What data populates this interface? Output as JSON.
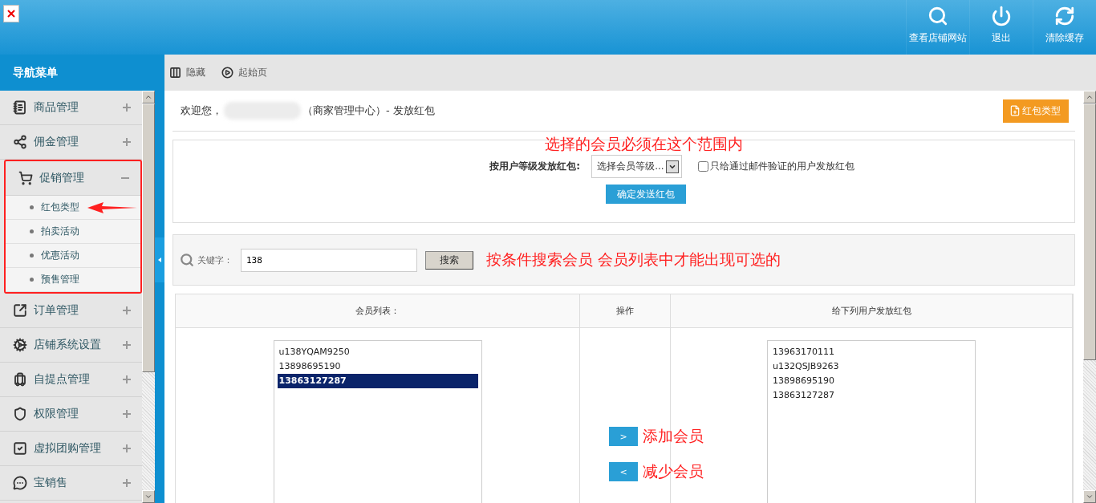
{
  "header": {
    "actions": [
      {
        "label": "查看店铺网站"
      },
      {
        "label": "退出"
      },
      {
        "label": "清除缓存"
      }
    ]
  },
  "sidebar": {
    "title": "导航菜单",
    "items": [
      {
        "label": "商品管理",
        "expanded": false,
        "highlighted": false
      },
      {
        "label": "佣金管理",
        "expanded": false,
        "highlighted": false
      },
      {
        "label": "促销管理",
        "expanded": true,
        "highlighted": true,
        "children": [
          {
            "label": "红包类型",
            "pointed": true
          },
          {
            "label": "拍卖活动",
            "pointed": false
          },
          {
            "label": "优惠活动",
            "pointed": false
          },
          {
            "label": "预售管理",
            "pointed": false
          }
        ]
      },
      {
        "label": "订单管理",
        "expanded": false,
        "highlighted": false
      },
      {
        "label": "店铺系统设置",
        "expanded": false,
        "highlighted": false
      },
      {
        "label": "自提点管理",
        "expanded": false,
        "highlighted": false
      },
      {
        "label": "权限管理",
        "expanded": false,
        "highlighted": false
      },
      {
        "label": "虚拟团购管理",
        "expanded": false,
        "highlighted": false
      },
      {
        "label": "宝销售",
        "expanded": false,
        "highlighted": false
      }
    ]
  },
  "toolbar": {
    "buttons": [
      {
        "label": "隐藏"
      },
      {
        "label": "起始页"
      }
    ]
  },
  "page": {
    "welcome": "欢迎您，",
    "title": "（商家管理中心）- 发放红包",
    "type_button": "红包类型"
  },
  "rank_panel": {
    "annotation": "选择的会员必须在这个范围内",
    "label": "按用户等级发放红包:",
    "select_value": "选择会员等级...",
    "checkbox": {
      "label": "只给通过邮件验证的用户发放红包",
      "checked": false
    },
    "submit": "确定发送红包"
  },
  "search": {
    "label": "关键字：",
    "value": "138",
    "button": "搜索",
    "annotation": "按条件搜索会员 会员列表中才能出现可选的"
  },
  "table": {
    "columns": [
      "会员列表：",
      "操作",
      "给下列用户发放红包"
    ]
  },
  "member_list": [
    {
      "text": "u138YQAM9250",
      "selected": false
    },
    {
      "text": "13898695190",
      "selected": false
    },
    {
      "text": "13863127287",
      "selected": true
    }
  ],
  "actions": [
    {
      "label": ">",
      "note": "添加会员"
    },
    {
      "label": "<",
      "note": "减少会员"
    }
  ],
  "target_list": [
    {
      "text": "13963170111",
      "selected": false
    },
    {
      "text": "u132QSJB9263",
      "selected": false
    },
    {
      "text": "13898695190",
      "selected": false
    },
    {
      "text": "13863127287",
      "selected": false
    }
  ]
}
